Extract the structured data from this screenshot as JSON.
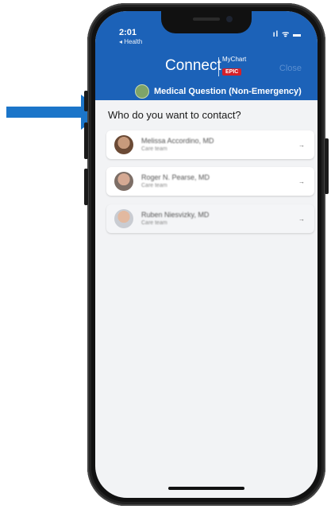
{
  "status_bar": {
    "time": "2:01",
    "back_app": "◂ Health",
    "signal_icons": "ıl ᯤ ▬"
  },
  "header": {
    "title": "Connect",
    "logo_text": "MyChart",
    "logo_badge": "EPIC",
    "close_label": "Close",
    "topic_label": "Medical Question (Non-Emergency)",
    "color": "#1c62b8"
  },
  "prompt": "Who do you want to contact?",
  "contacts": [
    {
      "name": "Melissa Accordino, MD",
      "role": "Care team"
    },
    {
      "name": "Roger N. Pearse, MD",
      "role": "Care team"
    },
    {
      "name": "Ruben Niesvizky, MD",
      "role": "Care team"
    }
  ],
  "annotation": {
    "arrow_color": "#1b75c9",
    "icon": "arrow-right-icon"
  }
}
